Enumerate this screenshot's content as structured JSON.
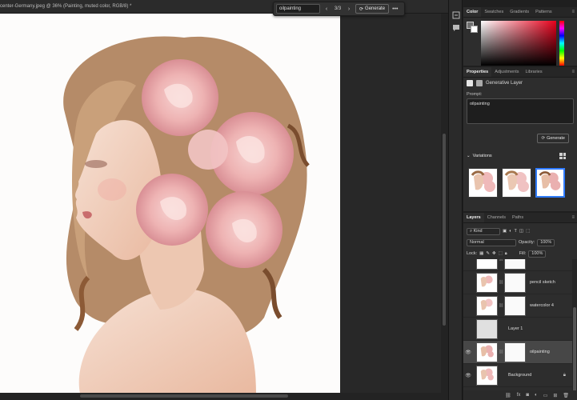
{
  "document": {
    "tab_title": "center-Germany.jpeg @ 36% (Painting, muted color, RGB/8) *"
  },
  "taskbar": {
    "prompt": "oilpainting",
    "prev_icon": "chevron-left-icon",
    "next_icon": "chevron-right-icon",
    "counter": "3/3",
    "generate_label": "Generate",
    "more_icon": "more-horizontal-icon"
  },
  "color_panel": {
    "tabs": [
      "Color",
      "Swatches",
      "Gradients",
      "Patterns"
    ],
    "foreground": "#6e6e6e",
    "background": "#ffffff",
    "field_hue": "#e8001b"
  },
  "properties_panel": {
    "tabs": [
      "Properties",
      "Adjustments",
      "Libraries"
    ],
    "layer_type": "Generative Layer",
    "prompt_label": "Prompt:",
    "prompt_value": "oilpainting",
    "generate_label": "Generate",
    "variations_label": "Variations",
    "selected_variation": 3
  },
  "layers_panel": {
    "tabs": [
      "Layers",
      "Channels",
      "Paths"
    ],
    "filter_kind": "Kind",
    "blend_mode": "Normal",
    "opacity_label": "Opacity:",
    "opacity_value": "100%",
    "lock_label": "Lock:",
    "fill_label": "Fill:",
    "fill_value": "100%",
    "layers": [
      {
        "name": "pencil sketch",
        "visible": false
      },
      {
        "name": "watercolor 4",
        "visible": false
      },
      {
        "name": "Layer 1",
        "visible": false
      },
      {
        "name": "oilpainting",
        "visible": true,
        "selected": true
      },
      {
        "name": "Background",
        "visible": true,
        "locked": true
      }
    ],
    "footer_icons": [
      "link-icon",
      "fx-icon",
      "mask-icon",
      "adjustment-icon",
      "folder-icon",
      "new-layer-icon",
      "trash-icon"
    ]
  },
  "colors": {
    "accent": "#2f7bff",
    "panel_bg": "#2d2d2d",
    "canvas_bg": "#282828"
  }
}
